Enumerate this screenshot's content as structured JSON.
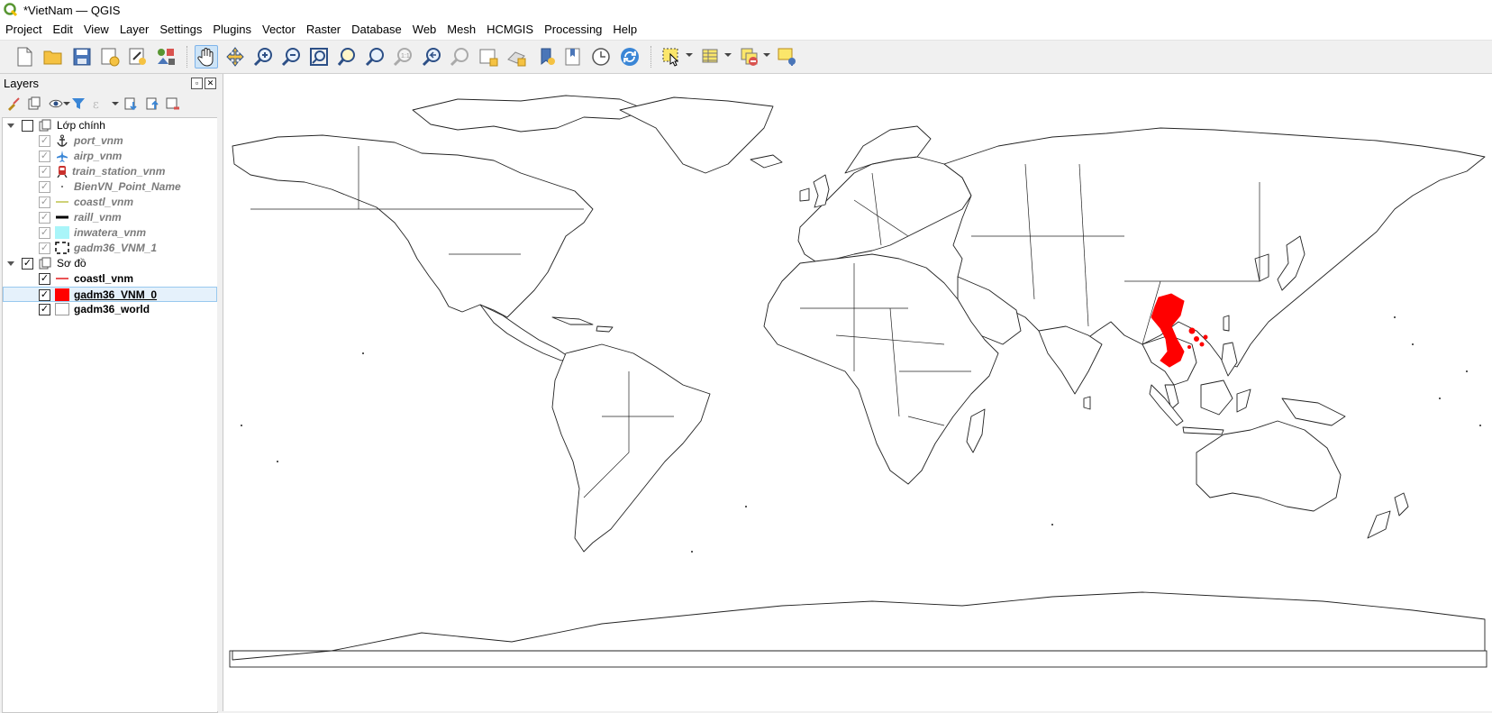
{
  "window": {
    "title": "*VietNam — QGIS"
  },
  "menu": [
    "Project",
    "Edit",
    "View",
    "Layer",
    "Settings",
    "Plugins",
    "Vector",
    "Raster",
    "Database",
    "Web",
    "Mesh",
    "HCMGIS",
    "Processing",
    "Help"
  ],
  "toolbar": {
    "buttons": [
      "new-project-icon",
      "open-project-icon",
      "save-project-icon",
      "new-print-layout-icon",
      "layout-manager-icon",
      "style-manager-icon",
      "pan-icon",
      "pan-to-selection-icon",
      "zoom-in-icon",
      "zoom-out-icon",
      "zoom-full-icon",
      "zoom-to-selection-icon",
      "zoom-to-layer-icon",
      "zoom-native-icon",
      "zoom-last-icon",
      "zoom-next-icon",
      "new-map-view-icon",
      "new-3d-map-view-icon",
      "new-bookmark-icon",
      "show-bookmarks-icon",
      "temporal-controller-icon",
      "refresh-icon",
      "select-features-icon",
      "attribute-table-icon",
      "deselect-all-icon",
      "show-map-tips-icon"
    ],
    "active": "pan-icon"
  },
  "layers_panel": {
    "title": "Layers",
    "groups": [
      {
        "name": "Lớp chính",
        "checked": false,
        "layers": [
          {
            "name": "port_vnm",
            "symbol": "anchor-icon",
            "checked": true
          },
          {
            "name": "airp_vnm",
            "symbol": "airplane-icon",
            "checked": true
          },
          {
            "name": "train_station_vnm",
            "symbol": "train-icon",
            "checked": true
          },
          {
            "name": "BienVN_Point_Name",
            "symbol": "dot-icon",
            "checked": true
          },
          {
            "name": "coastl_vnm",
            "symbol": "line-olive",
            "checked": true
          },
          {
            "name": "raill_vnm",
            "symbol": "line-black",
            "checked": true
          },
          {
            "name": "inwatera_vnm",
            "symbol": "fill-cyan",
            "checked": true
          },
          {
            "name": "gadm36_VNM_1",
            "symbol": "fill-dashed",
            "checked": true
          }
        ]
      },
      {
        "name": "Sơ đồ",
        "checked": true,
        "layers": [
          {
            "name": "coastl_vnm",
            "symbol": "line-red",
            "checked": true
          },
          {
            "name": "gadm36_VNM_0",
            "symbol": "fill-red",
            "checked": true,
            "selected": true
          },
          {
            "name": "gadm36_world",
            "symbol": "fill-white",
            "checked": true
          }
        ]
      }
    ]
  },
  "colors": {
    "highlight": "#ff0000",
    "selection": "#e5f1fb",
    "water": "#a9f5f9"
  }
}
